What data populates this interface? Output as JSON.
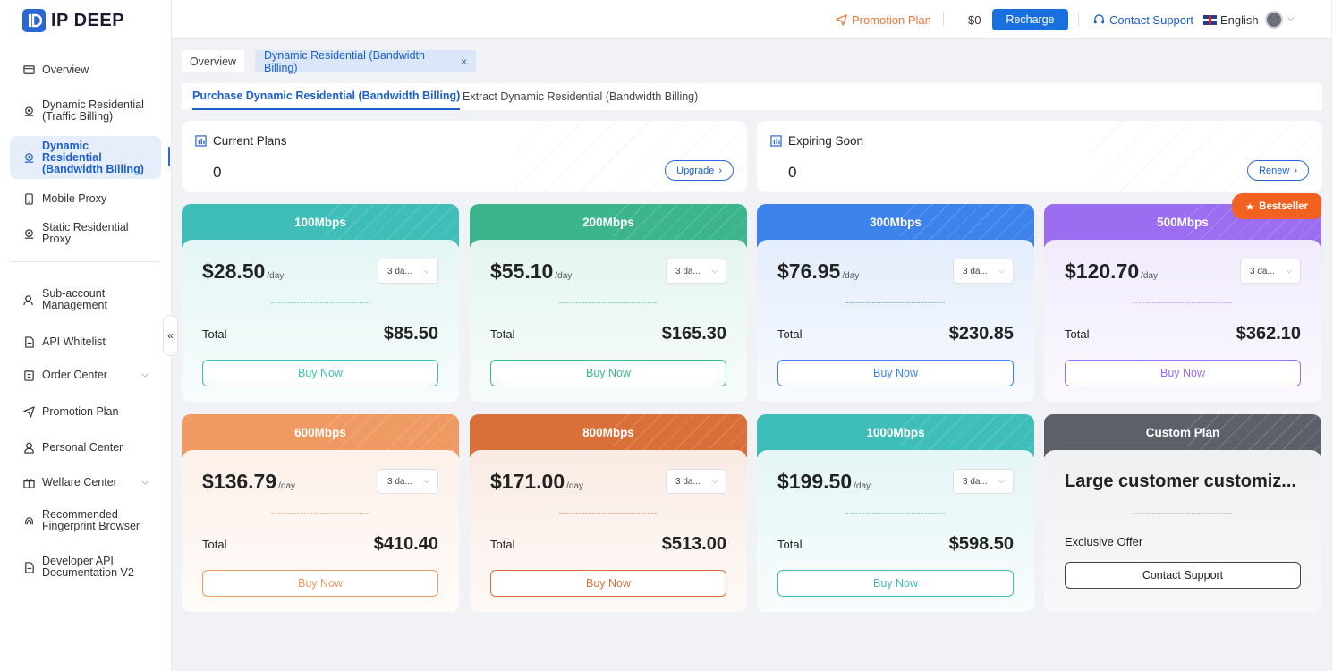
{
  "brand": {
    "name": "IP DEEP"
  },
  "sidebar": {
    "items": [
      {
        "label": "Overview",
        "icon": "monitor-icon"
      },
      {
        "label": "Dynamic Residential\n(Traffic Billing)",
        "icon": "location-pin-icon"
      },
      {
        "label": "Dynamic Residential\n(Bandwidth Billing)",
        "icon": "location-pin-icon",
        "active": true
      },
      {
        "label": "Mobile Proxy",
        "icon": "mobile-icon"
      },
      {
        "label": "Static Residential Proxy",
        "icon": "location-pin-icon"
      },
      {
        "label": "Sub-account\nManagement",
        "icon": "users-icon"
      },
      {
        "label": "API Whitelist",
        "icon": "document-icon"
      },
      {
        "label": "Order Center",
        "icon": "clipboard-icon",
        "expandable": true
      },
      {
        "label": "Promotion Plan",
        "icon": "paper-plane-icon"
      },
      {
        "label": "Personal Center",
        "icon": "user-icon"
      },
      {
        "label": "Welfare Center",
        "icon": "gift-icon",
        "expandable": true
      },
      {
        "label": "Recommended\nFingerprint Browser",
        "icon": "fingerprint-icon"
      },
      {
        "label": "Developer API\nDocumentation V2",
        "icon": "document-icon"
      }
    ],
    "collapse_glyph": "«"
  },
  "topbar": {
    "promotion_label": "Promotion Plan",
    "balance": "$0",
    "recharge_label": "Recharge",
    "support_label": "Contact Support",
    "language": "English"
  },
  "tags": {
    "overview": "Overview",
    "active": "Dynamic Residential (Bandwidth Billing)",
    "close_glyph": "×"
  },
  "subtabs": {
    "purchase": "Purchase Dynamic Residential (Bandwidth Billing)",
    "extract": "Extract Dynamic Residential (Bandwidth Billing)"
  },
  "info_cards": {
    "current": {
      "title": "Current Plans",
      "value": "0",
      "button": "Upgrade"
    },
    "expiring": {
      "title": "Expiring Soon",
      "value": "0",
      "button": "Renew"
    }
  },
  "badge": {
    "label": "Bestseller"
  },
  "plans": [
    {
      "name": "100Mbps",
      "price": "$28.50",
      "unit": "/day",
      "duration": "3 da...",
      "total_label": "Total",
      "total": "$85.50",
      "buy_label": "Buy Now",
      "color": "#3fbdb8"
    },
    {
      "name": "200Mbps",
      "price": "$55.10",
      "unit": "/day",
      "duration": "3 da...",
      "total_label": "Total",
      "total": "$165.30",
      "buy_label": "Buy Now",
      "color": "#3db58c"
    },
    {
      "name": "300Mbps",
      "price": "$76.95",
      "unit": "/day",
      "duration": "3 da...",
      "total_label": "Total",
      "total": "$230.85",
      "buy_label": "Buy Now",
      "color": "#3e82ec"
    },
    {
      "name": "500Mbps",
      "price": "$120.70",
      "unit": "/day",
      "duration": "3 da...",
      "total_label": "Total",
      "total": "$362.10",
      "buy_label": "Buy Now",
      "color": "#9b6df0"
    },
    {
      "name": "600Mbps",
      "price": "$136.79",
      "unit": "/day",
      "duration": "3 da...",
      "total_label": "Total",
      "total": "$410.40",
      "buy_label": "Buy Now",
      "color": "#ef9a62"
    },
    {
      "name": "800Mbps",
      "price": "$171.00",
      "unit": "/day",
      "duration": "3 da...",
      "total_label": "Total",
      "total": "$513.00",
      "buy_label": "Buy Now",
      "color": "#d9703a"
    },
    {
      "name": "1000Mbps",
      "price": "$199.50",
      "unit": "/day",
      "duration": "3 da...",
      "total_label": "Total",
      "total": "$598.50",
      "buy_label": "Buy Now",
      "color": "#3fbdb8"
    }
  ],
  "custom_plan": {
    "name": "Custom Plan",
    "title": "Large customer customiz...",
    "subtitle": "Exclusive Offer",
    "button": "Contact Support",
    "color": "#5d6068"
  }
}
